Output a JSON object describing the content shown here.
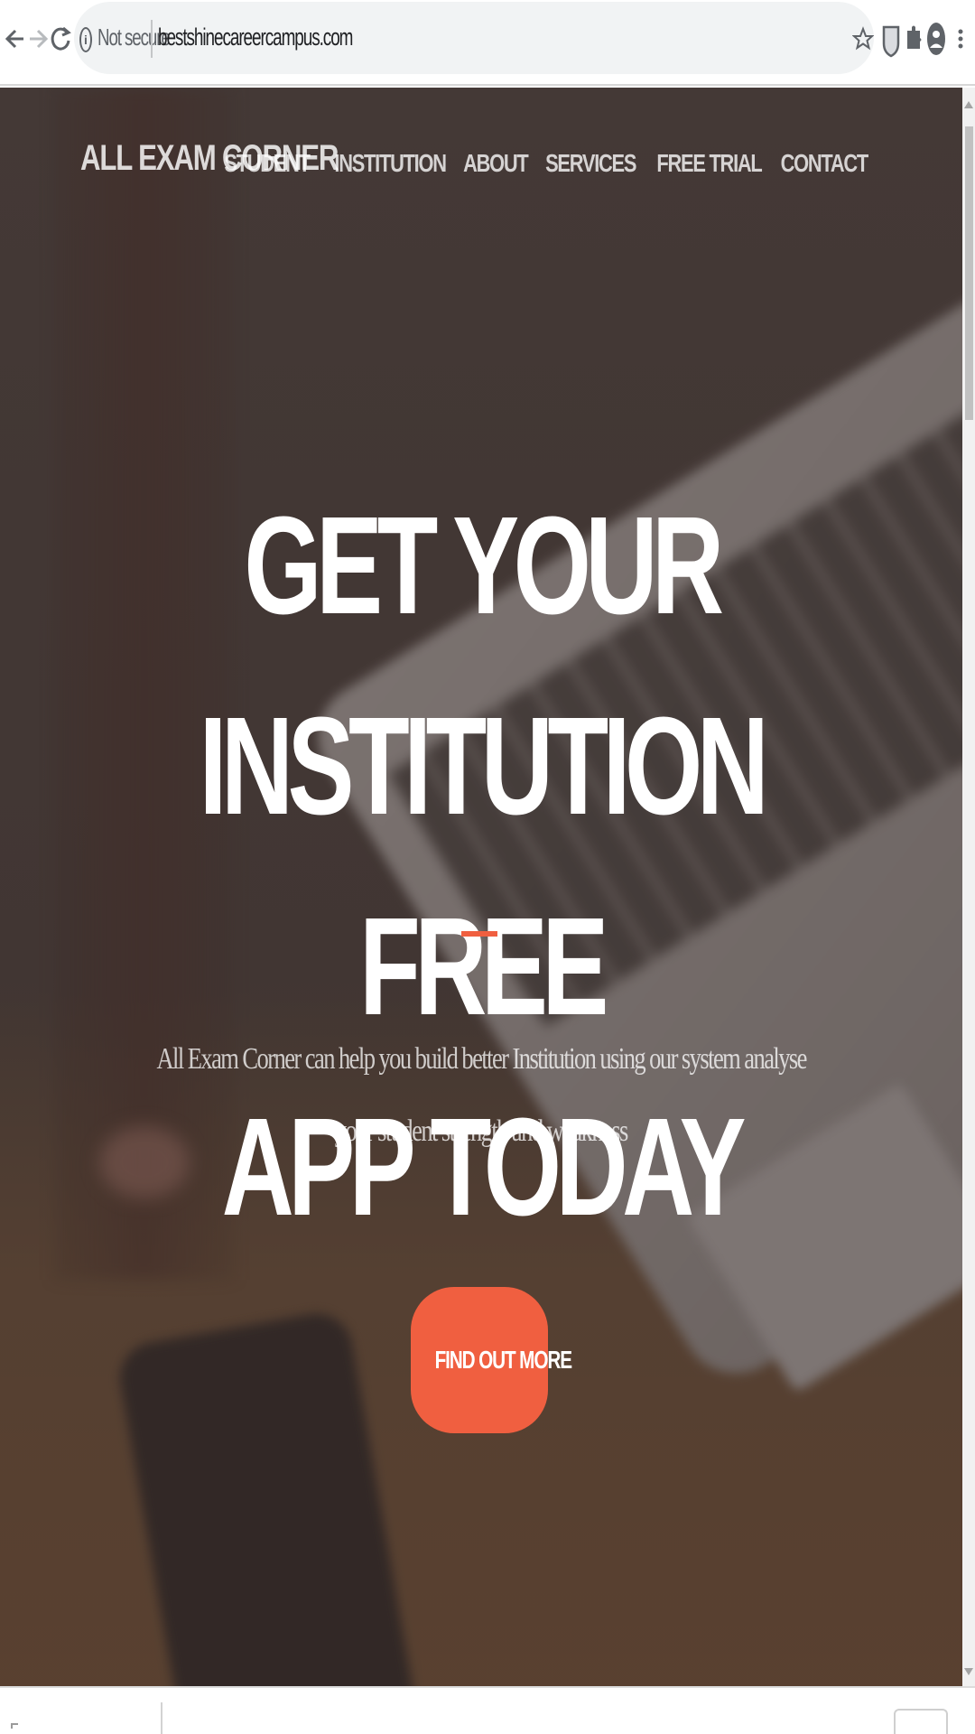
{
  "browser": {
    "security_label": "Not secure",
    "url": "bestshinecareercampus.com",
    "icons": [
      "back-arrow-icon",
      "forward-arrow-icon",
      "reload-icon",
      "info-icon",
      "star-icon",
      "extension-shield-icon",
      "puzzle-icon",
      "profile-icon",
      "more-menu-icon"
    ]
  },
  "site": {
    "brand": "ALL EXAM CORNER",
    "nav": [
      {
        "label": "STUDENT"
      },
      {
        "label": "INSTITUTION"
      },
      {
        "label": "ABOUT"
      },
      {
        "label": "SERVICES"
      },
      {
        "label": "FREE TRIAL"
      },
      {
        "label": "CONTACT"
      }
    ]
  },
  "hero": {
    "headline_line1": "GET YOUR INSTITUTION FREE",
    "headline_line2": "APP TODAY",
    "subtext_line1": "All Exam Corner can help you build better Institution using our system analyse",
    "subtext_line2": "your student strength and weakness",
    "cta_label": "FIND OUT MORE"
  },
  "colors": {
    "accent": "#f05f40",
    "hero_overlay": "#4a3f3c",
    "omnibox": "#f1f3f4"
  }
}
